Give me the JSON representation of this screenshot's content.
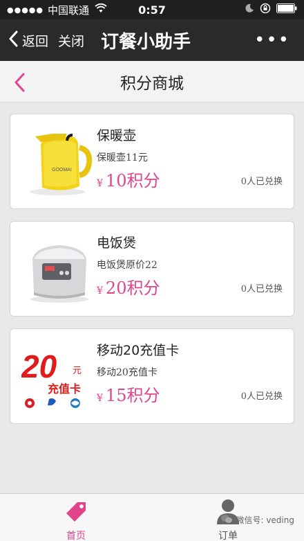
{
  "status_bar": {
    "signal": "●●●●●",
    "carrier": "中国联通",
    "time": "0:57"
  },
  "nav": {
    "back_label": "返回",
    "close_label": "关闭",
    "title": "订餐小助手",
    "more": "•••"
  },
  "page": {
    "title": "积分商城"
  },
  "currency_symbol": "¥",
  "products": [
    {
      "name": "保暖壶",
      "desc": "保暖壶11元",
      "price": "10积分",
      "redeemed": "0人已兑换",
      "image": "thermos-image",
      "brand_text": "GOOMAI"
    },
    {
      "name": "电饭煲",
      "desc": "电饭煲原价22",
      "price": "20积分",
      "redeemed": "0人已兑换",
      "image": "rice-cooker-image"
    },
    {
      "name": "移动20充值卡",
      "desc": "移动20充值卡",
      "price": "15积分",
      "redeemed": "0人已兑换",
      "image": "recharge-card-image",
      "card_amount": "20",
      "card_unit": "元",
      "card_text": "充值卡"
    }
  ],
  "tabs": [
    {
      "label": "首页",
      "icon": "tag-icon",
      "color": "#e0458c"
    },
    {
      "label": "订单",
      "icon": "person-icon",
      "color": "#555555"
    }
  ],
  "watermark": "微信号: veding",
  "colors": {
    "accent": "#e0458c",
    "nav_bg": "#2a2a2a",
    "status_bg": "#1f1f1f"
  }
}
